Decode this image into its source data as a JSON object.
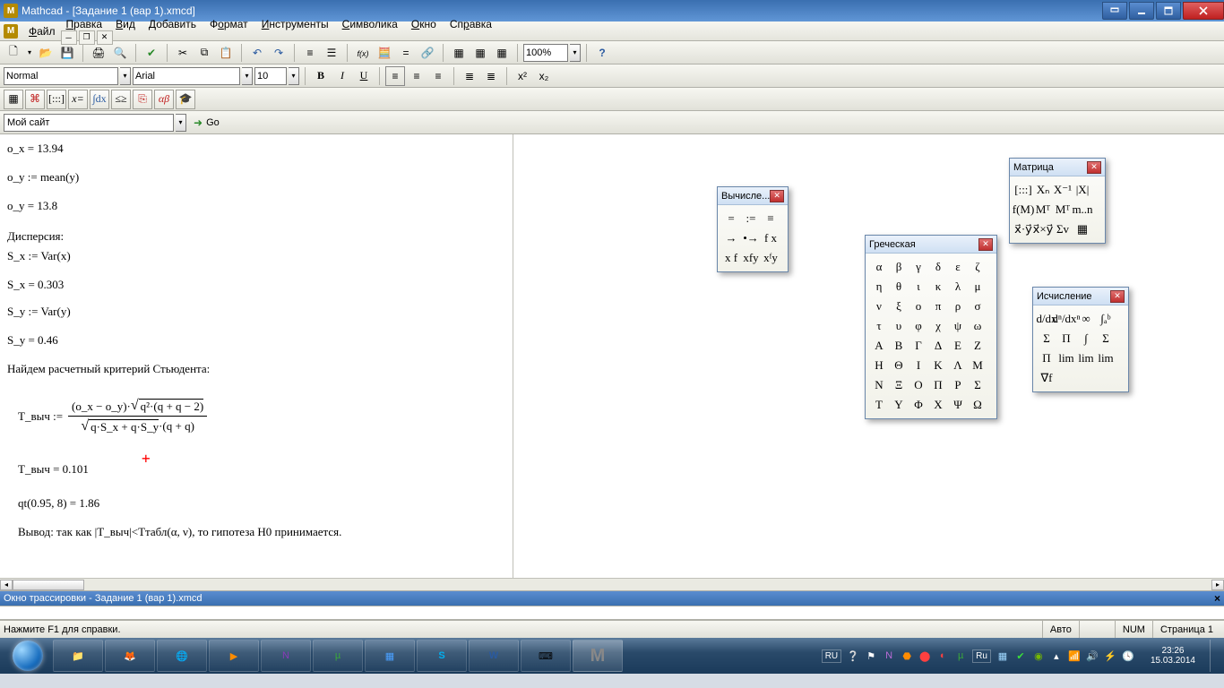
{
  "app": {
    "title": "Mathcad - [Задание 1 (вар 1).xmcd]"
  },
  "menu": {
    "items": [
      "Файл",
      "Правка",
      "Вид",
      "Добавить",
      "Формат",
      "Инструменты",
      "Символика",
      "Окно",
      "Справка"
    ]
  },
  "toolbar": {
    "zoom": "100%"
  },
  "format_bar": {
    "style": "Normal",
    "font": "Arial",
    "size": "10"
  },
  "sitebar": {
    "site": "Мой сайт",
    "go": "Go"
  },
  "doc": {
    "l1": "o_x = 13.94",
    "l2": "o_y := mean(y)",
    "l3": "o_y = 13.8",
    "l4": "Дисперсия:",
    "l5": "S_x := Var(x)",
    "l6": "S_x = 0.303",
    "l7": "S_y := Var(y)",
    "l8": "S_y = 0.46",
    "l9": "Найдем расчетный критерий Стьюдента:",
    "formula_label": "T_выч :=",
    "formula_num_a": "(o_x − o_y)·",
    "formula_num_b": "q²·(q + q − 2)",
    "formula_den_a": "q·S_x + q·S_y",
    "formula_den_b": "·(q + q)",
    "l11": "T_выч = 0.101",
    "l12": "qt(0.95, 8) = 1.86",
    "l13": "Вывод: так как |T_выч|<Tтабл(α, ν), то гипотеза Н0 принимается."
  },
  "palettes": {
    "calc": {
      "title": "Вычисле...",
      "cells": [
        "=",
        ":=",
        "≡",
        "→",
        "•→",
        "f x",
        "x f",
        "xfy",
        "xᶠy"
      ]
    },
    "greek": {
      "title": "Греческая",
      "cells": [
        "α",
        "β",
        "γ",
        "δ",
        "ε",
        "ζ",
        "η",
        "θ",
        "ι",
        "κ",
        "λ",
        "μ",
        "ν",
        "ξ",
        "ο",
        "π",
        "ρ",
        "σ",
        "τ",
        "υ",
        "φ",
        "χ",
        "ψ",
        "ω",
        "Α",
        "Β",
        "Γ",
        "Δ",
        "Ε",
        "Ζ",
        "Η",
        "Θ",
        "Ι",
        "Κ",
        "Λ",
        "Μ",
        "Ν",
        "Ξ",
        "Ο",
        "Π",
        "Ρ",
        "Σ",
        "Τ",
        "Υ",
        "Φ",
        "Χ",
        "Ψ",
        "Ω"
      ]
    },
    "matrix": {
      "title": "Матрица",
      "cells": [
        "[:::]",
        "Xₙ",
        "X⁻¹",
        "|X|",
        "f(M)",
        "Mᵀ",
        "Mᵀ",
        "m..n",
        "x⃗·y⃗",
        "x⃗×y⃗",
        "Σv",
        "▦"
      ]
    },
    "calculus": {
      "title": "Исчисление",
      "cells": [
        "d/dx",
        "dⁿ/dxⁿ",
        "∞",
        "∫ₐᵇ",
        "Σ",
        "Π",
        "∫",
        "Σ",
        "Π",
        "lim",
        "lim",
        "lim",
        "∇f",
        "",
        "",
        ""
      ]
    }
  },
  "tracebar": {
    "title": "Окно трассировки - Задание 1 (вар 1).xmcd"
  },
  "statusbar": {
    "hint": "Нажмите F1 для справки.",
    "auto": "Авто",
    "num": "NUM",
    "page": "Страница 1"
  },
  "tray": {
    "lang": "RU",
    "time": "23:26",
    "date": "15.03.2014"
  }
}
